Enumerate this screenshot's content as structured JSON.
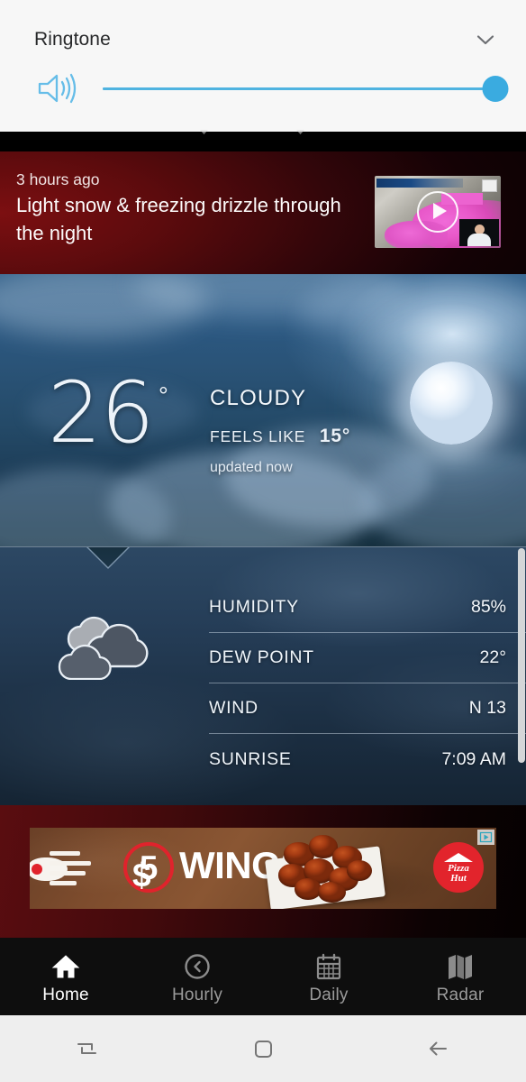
{
  "volume_panel": {
    "title": "Ringtone",
    "collapse_icon": "chevron-down-icon",
    "speaker_icon": "speaker-volume-icon",
    "slider": {
      "value": 100,
      "min": 0,
      "max": 100
    },
    "accent_color": "#3aabe0",
    "background_color": "#f7f7f7"
  },
  "alert": {
    "timestamp": "3 hours ago",
    "headline": "Light snow & freezing drizzle through the night",
    "play_icon": "play-circle-icon",
    "thumbnail_name": "weather-radar-video-thumbnail",
    "background_color": "#5c0b0d"
  },
  "hero": {
    "temperature": "26",
    "degree": "°",
    "condition": "CLOUDY",
    "feels_like_label": "FEELS LIKE",
    "feels_like_value": "15°",
    "updated": "updated now",
    "background_name": "night-sky-moon-clouds"
  },
  "details": {
    "condition_icon": "cloudy-clouds-icon",
    "rows": [
      {
        "label": "HUMIDITY",
        "value": "85%"
      },
      {
        "label": "DEW POINT",
        "value": "22°"
      },
      {
        "label": "WIND",
        "value": "N 13"
      },
      {
        "label": "SUNRISE",
        "value": "7:09 AM"
      }
    ]
  },
  "ad": {
    "price": "5",
    "currency": "$",
    "product": "WINGS",
    "brand": "Pizza Hut",
    "brand_line1": "Pizza",
    "brand_line2": "Hut",
    "ad_choices_icon": "ad-choices-icon",
    "brand_color": "#e2242c"
  },
  "tabs": [
    {
      "label": "Home",
      "icon": "home-icon",
      "active": true
    },
    {
      "label": "Hourly",
      "icon": "clock-icon",
      "active": false
    },
    {
      "label": "Daily",
      "icon": "calendar-icon",
      "active": false
    },
    {
      "label": "Radar",
      "icon": "map-icon",
      "active": false
    }
  ],
  "system_nav": [
    {
      "name": "recents-button",
      "icon": "recents-icon"
    },
    {
      "name": "home-button",
      "icon": "rounded-square-icon"
    },
    {
      "name": "back-button",
      "icon": "back-arrow-icon"
    }
  ]
}
